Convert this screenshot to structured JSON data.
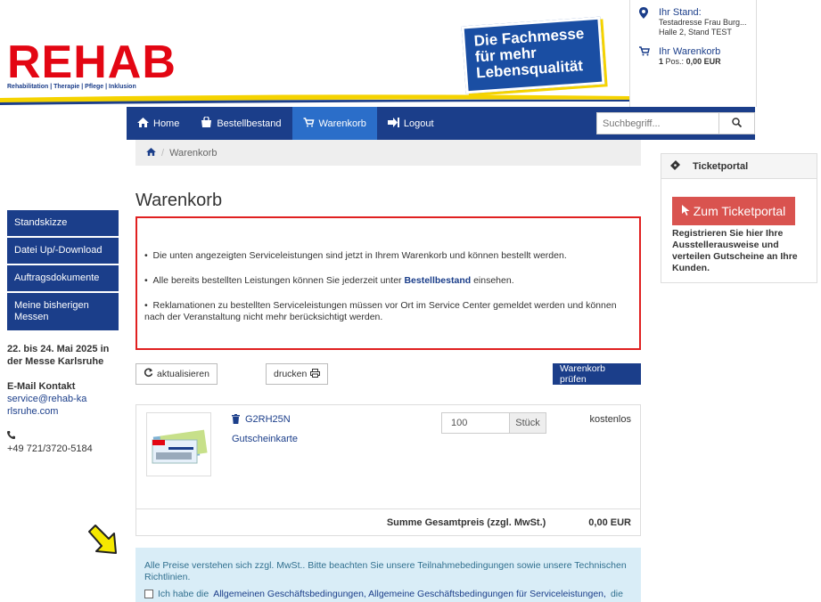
{
  "header": {
    "logo_text": "REHAB",
    "logo_sub": "Rehabilitation | Therapie | Pflege | Inklusion",
    "banner_line1": "Die Fachmesse",
    "banner_line2": "für mehr",
    "banner_line3": "Lebensqualität"
  },
  "stand": {
    "title": "Ihr Stand:",
    "line1": "Testadresse Frau Burg...",
    "line2": "Halle 2, Stand TEST",
    "cart_title": "Ihr Warenkorb",
    "cart_pos": "1",
    "cart_pos_label": "Pos.:",
    "cart_sum": "0,00 EUR"
  },
  "nav": {
    "home": "Home",
    "bestellbestand": "Bestellbestand",
    "warenkorb": "Warenkorb",
    "logout": "Logout",
    "search_placeholder": "Suchbegriff..."
  },
  "breadcrumb": {
    "current": "Warenkorb"
  },
  "sidebar": {
    "items": [
      "Standskizze",
      "Datei Up/-Download",
      "Auftragsdokumente",
      "Meine bisherigen Messen"
    ],
    "date_text": "22. bis 24. Mai 2025 in der Messe Karlsruhe",
    "contact_title": "E-Mail Kontakt",
    "email": "service@rehab-karlsruhe.com",
    "phone": "+49 721/3720-5184"
  },
  "main": {
    "title": "Warenkorb",
    "alert_1": "Die unten angezeigten Serviceleistungen sind jetzt in Ihrem Warenkorb und können bestellt werden.",
    "alert_2_pre": "Alle bereits bestellten Leistungen können Sie jederzeit unter",
    "alert_2_link": "Bestellbestand",
    "alert_2_post": "einsehen.",
    "alert_3": "Reklamationen zu bestellten Serviceleistungen müssen vor Ort im Service Center gemeldet werden und können nach der Veranstaltung nicht mehr berücksichtigt werden.",
    "btn_refresh": "aktualisieren",
    "btn_print": "drucken",
    "btn_check": "Warenkorb prüfen"
  },
  "cart": {
    "item_code": "G2RH25N",
    "item_name": "Gutscheinkarte",
    "quantity": "100",
    "unit": "Stück",
    "price": "kostenlos",
    "sum_label": "Summe Gesamtpreis (zzgl. MwSt.)",
    "sum_value": "0,00 EUR"
  },
  "info": {
    "text": "Alle Preise verstehen sich zzgl. MwSt.. Bitte beachten Sie unsere Teilnahmebedingungen sowie unsere Technischen Richtlinien.",
    "agb_pre": "Ich habe die",
    "agb_link": "Allgemeinen Geschäftsbedingungen, Allgemeine Geschäftsbedingungen für Serviceleistungen,",
    "agb_post": "die"
  },
  "ticket": {
    "title": "Ticketportal",
    "button": "Zum Ticketportal",
    "text": "Registrieren Sie hier Ihre Ausstellerausweise und verteilen Gutscheine an Ihre Kunden."
  },
  "colors": {
    "brand_blue": "#1b3e8a",
    "active_blue": "#2b6ec9",
    "logo_red": "#e30613",
    "alert_red": "#e02020",
    "ticket_red": "#d9534f",
    "info_bg": "#d9edf7"
  }
}
